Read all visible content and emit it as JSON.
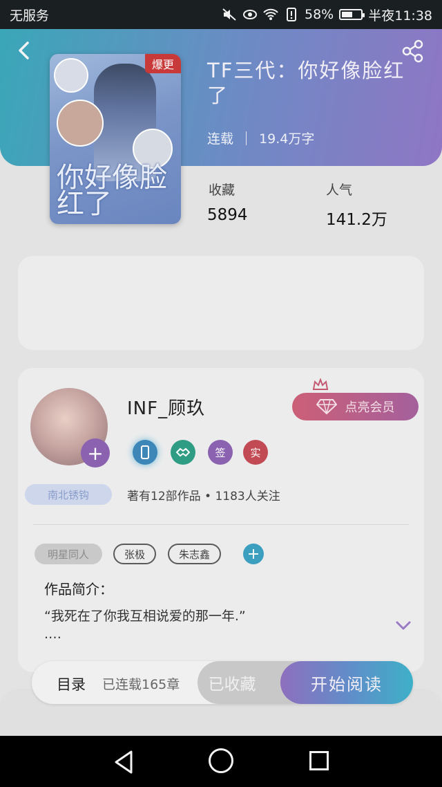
{
  "status_bar": {
    "carrier": "无服务",
    "battery_percent": "58%",
    "battery_level": 0.58,
    "time": "半夜11:38",
    "icons": [
      "mute-icon",
      "eye-comfort-icon",
      "wifi-icon",
      "alert-icon",
      "battery-icon"
    ]
  },
  "header": {
    "back_icon": "chevron-left-icon",
    "share_icon": "share-icon",
    "colors": {
      "gradient_start": "#3aa7b8",
      "gradient_end": "#8f76c4"
    }
  },
  "book": {
    "cover_badge": "爆更",
    "cover_title": "你好像脸红了",
    "title": "TF三代：你好像脸红了",
    "status": "连载",
    "word_count": "19.4万字",
    "collect_label": "收藏",
    "collect_value": "5894",
    "popularity_label": "人气",
    "popularity_value": "141.2万"
  },
  "author": {
    "name": "INF_顾玖",
    "vip_button": "点亮会员",
    "medals": [
      "",
      "",
      "签",
      "实"
    ],
    "tag_pill": "南北锈钩",
    "stats": "著有12部作品 • 1183人关注"
  },
  "tags": [
    "明星同人",
    "张极",
    "朱志鑫"
  ],
  "intro": {
    "title": "作品简介：",
    "text": "“我死在了你我互相说爱的那一年.”",
    "ellipsis": ".…"
  },
  "actions": {
    "toc": "目录",
    "toc_sub": "已连载165章",
    "collected": "已收藏",
    "read": "开始阅读",
    "colors": {
      "read_start": "#8e6fbe",
      "read_end": "#3eb0c8"
    }
  },
  "nav": {
    "icons": [
      "nav-back-icon",
      "nav-home-icon",
      "nav-recents-icon"
    ]
  }
}
